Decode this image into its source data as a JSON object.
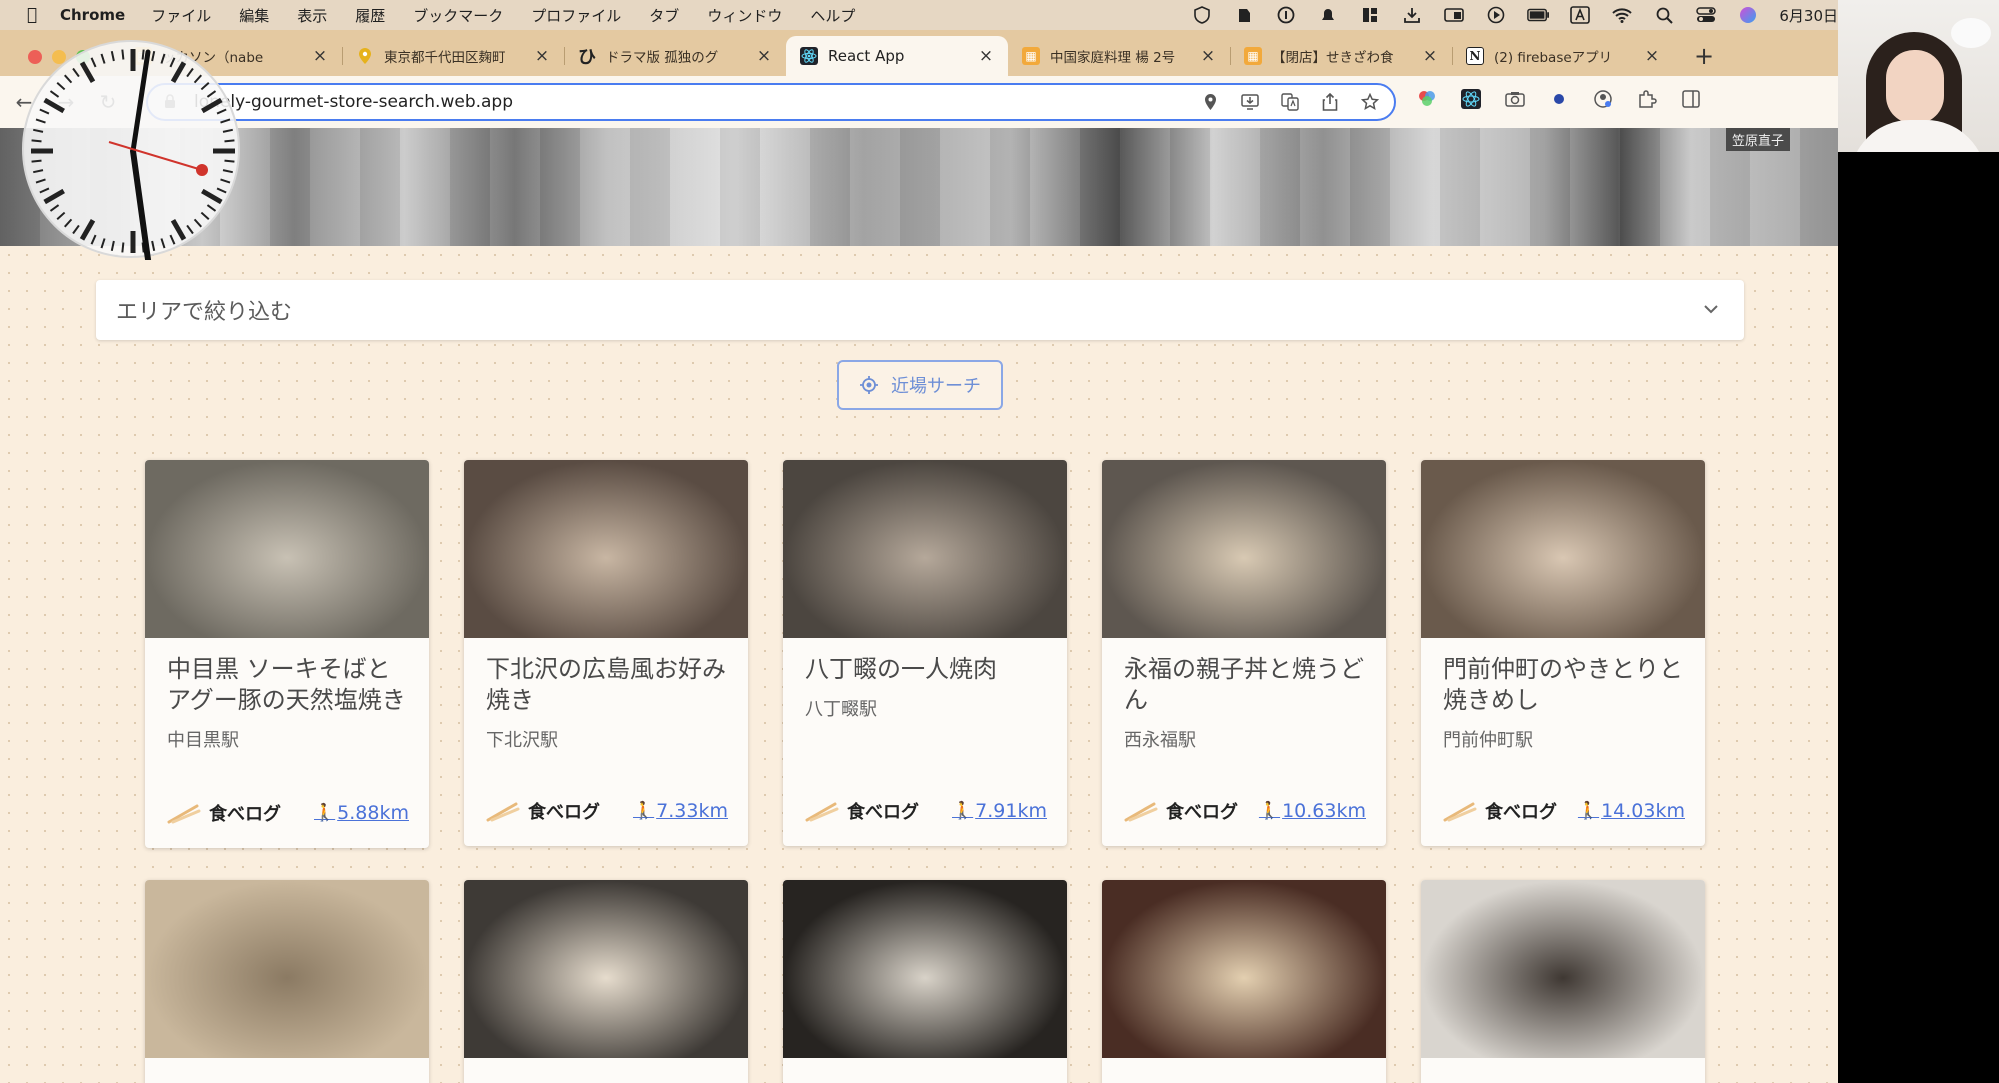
{
  "menubar": {
    "app_name": "Chrome",
    "items": [
      "ファイル",
      "編集",
      "表示",
      "履歴",
      "ブックマーク",
      "プロファイル",
      "タブ",
      "ウィンドウ",
      "ヘルプ"
    ],
    "date": "6月30日"
  },
  "tabs": [
    {
      "title": "ッカソン（nabe",
      "icon": "folder-icon",
      "active": false
    },
    {
      "title": "東京都千代田区麹町",
      "icon": "map-pin-icon",
      "active": false
    },
    {
      "title": "ドラマ版 孤独のグ",
      "icon": "hatena-icon",
      "active": false
    },
    {
      "title": "React App",
      "icon": "react-icon",
      "active": true
    },
    {
      "title": "中国家庭料理 楊 2号",
      "icon": "tabelog-icon",
      "active": false
    },
    {
      "title": "【閉店】せきざわ食",
      "icon": "tabelog-icon",
      "active": false
    },
    {
      "title": "(2) firebaseアプリ",
      "icon": "notion-icon",
      "active": false
    }
  ],
  "address_bar": {
    "url": "lonely-gourmet-store-search.web.app"
  },
  "page": {
    "area_filter_placeholder": "エリアで絞り込む",
    "nearby_search_label": "近場サーチ"
  },
  "cards": [
    {
      "title": "中目黒 ソーキそばとアグー豚の天然塩焼き",
      "station": "中目黒駅",
      "source": "食べログ",
      "distance": "5.88km",
      "photo_tone": [
        "#6e6a61",
        "#c8c1b4"
      ]
    },
    {
      "title": "下北沢の広島風お好み焼き",
      "station": "下北沢駅",
      "source": "食べログ",
      "distance": "7.33km",
      "photo_tone": [
        "#5a4c43",
        "#c8b6a3"
      ]
    },
    {
      "title": "八丁畷の一人焼肉",
      "station": "八丁畷駅",
      "source": "食べログ",
      "distance": "7.91km",
      "photo_tone": [
        "#4c4640",
        "#b5a89a"
      ]
    },
    {
      "title": "永福の親子丼と焼うどん",
      "station": "西永福駅",
      "source": "食べログ",
      "distance": "10.63km",
      "photo_tone": [
        "#5e5750",
        "#d8c9b3"
      ]
    },
    {
      "title": "門前仲町のやきとりと焼きめし",
      "station": "門前仲町駅",
      "source": "食べログ",
      "distance": "14.03km",
      "photo_tone": [
        "#6a5a4c",
        "#d9c7b3"
      ]
    },
    {
      "title": "",
      "station": "",
      "source": "",
      "distance": "",
      "photo_tone": [
        "#c9b79c",
        "#8b7a63"
      ]
    },
    {
      "title": "",
      "station": "",
      "source": "",
      "distance": "",
      "photo_tone": [
        "#3e3a36",
        "#e6dccd"
      ]
    },
    {
      "title": "",
      "station": "",
      "source": "",
      "distance": "",
      "photo_tone": [
        "#272421",
        "#d8d2c8"
      ]
    },
    {
      "title": "",
      "station": "",
      "source": "",
      "distance": "",
      "photo_tone": [
        "#4a2d24",
        "#e3cfb0"
      ]
    },
    {
      "title": "",
      "station": "",
      "source": "",
      "distance": "",
      "photo_tone": [
        "#d9d5cf",
        "#3f3833"
      ]
    }
  ],
  "webcam": {
    "name_tag": "笠原直子"
  },
  "colors": {
    "accent_link": "#4b72d8",
    "nearby_button": "#6e8fd6",
    "page_background": "#faeede",
    "omnibox_border": "#4a7cf0"
  }
}
